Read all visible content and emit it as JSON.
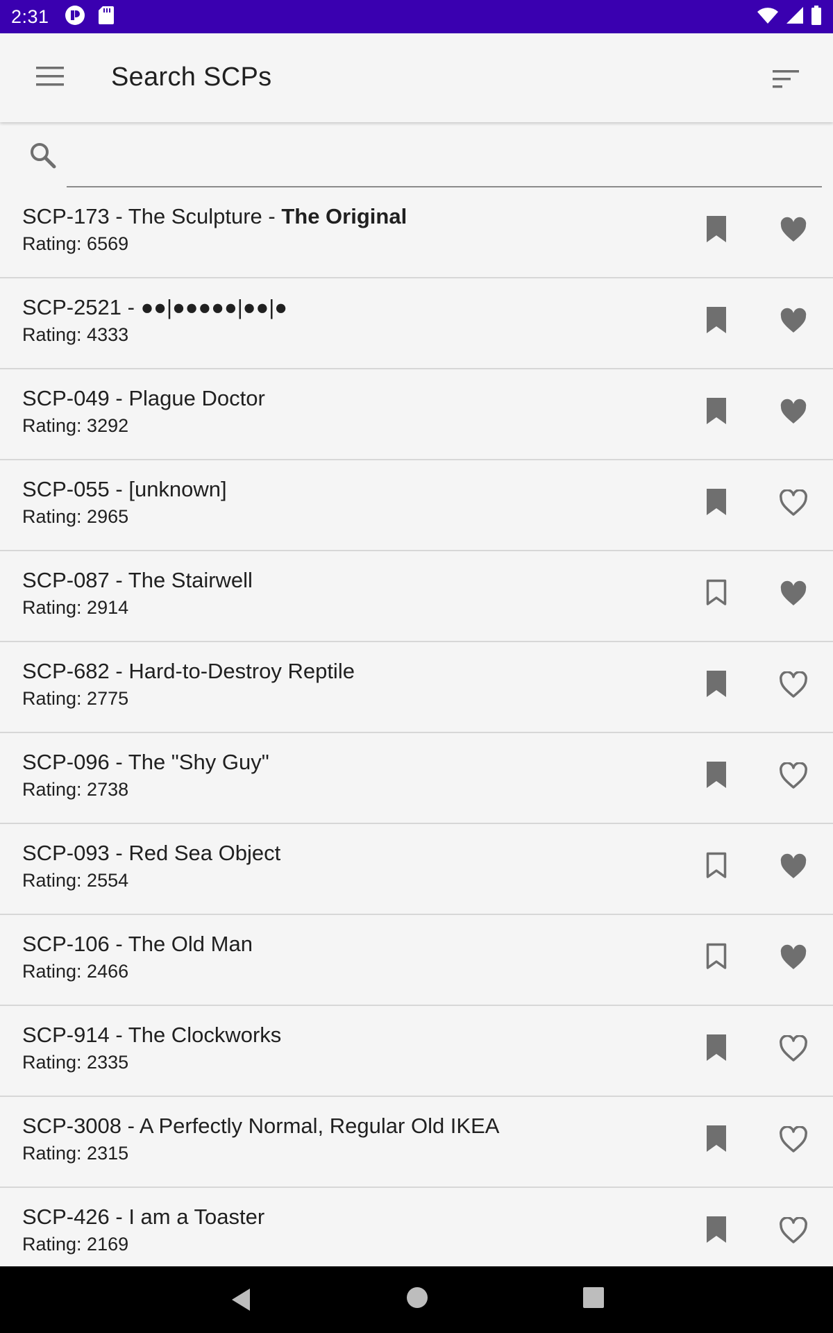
{
  "status_bar": {
    "time": "2:31",
    "left_icons": [
      "notification-app-icon",
      "sd-card-icon"
    ],
    "right_icons": [
      "wifi-icon",
      "cell-signal-icon",
      "battery-icon"
    ],
    "background": "#3a00b0"
  },
  "app_bar": {
    "title": "Search SCPs",
    "menu_icon": "hamburger-menu-icon",
    "sort_icon": "sort-icon"
  },
  "search": {
    "value": "",
    "placeholder": "",
    "icon": "search-icon"
  },
  "items": [
    {
      "title": "SCP-173 - The Sculpture - ",
      "title_bold": "The Original",
      "rating": "Rating: 6569",
      "bookmarked": true,
      "favorited": true
    },
    {
      "title": "SCP-2521 - ●●|●●●●●|●●|●",
      "title_bold": "",
      "rating": "Rating: 4333",
      "bookmarked": true,
      "favorited": true
    },
    {
      "title": "SCP-049 - Plague Doctor",
      "title_bold": "",
      "rating": "Rating: 3292",
      "bookmarked": true,
      "favorited": true
    },
    {
      "title": "SCP-055 - [unknown]",
      "title_bold": "",
      "rating": "Rating: 2965",
      "bookmarked": true,
      "favorited": false
    },
    {
      "title": "SCP-087 - The Stairwell",
      "title_bold": "",
      "rating": "Rating: 2914",
      "bookmarked": false,
      "favorited": true
    },
    {
      "title": "SCP-682 - Hard-to-Destroy Reptile",
      "title_bold": "",
      "rating": "Rating: 2775",
      "bookmarked": true,
      "favorited": false
    },
    {
      "title": "SCP-096 - The \"Shy Guy\"",
      "title_bold": "",
      "rating": "Rating: 2738",
      "bookmarked": true,
      "favorited": false
    },
    {
      "title": "SCP-093 - Red Sea Object",
      "title_bold": "",
      "rating": "Rating: 2554",
      "bookmarked": false,
      "favorited": true
    },
    {
      "title": "SCP-106 - The Old Man",
      "title_bold": "",
      "rating": "Rating: 2466",
      "bookmarked": false,
      "favorited": true
    },
    {
      "title": "SCP-914 - The Clockworks",
      "title_bold": "",
      "rating": "Rating: 2335",
      "bookmarked": true,
      "favorited": false
    },
    {
      "title": "SCP-3008 - A Perfectly Normal, Regular Old IKEA",
      "title_bold": "",
      "rating": "Rating: 2315",
      "bookmarked": true,
      "favorited": false
    },
    {
      "title": "SCP-426 - I am a Toaster",
      "title_bold": "",
      "rating": "Rating: 2169",
      "bookmarked": true,
      "favorited": false
    }
  ],
  "nav_bar": {
    "buttons": [
      "back-icon",
      "home-icon",
      "recents-icon"
    ]
  },
  "colors": {
    "icon_grey": "#6f6f6f",
    "divider": "#d7d7d7",
    "background": "#f5f5f5"
  }
}
